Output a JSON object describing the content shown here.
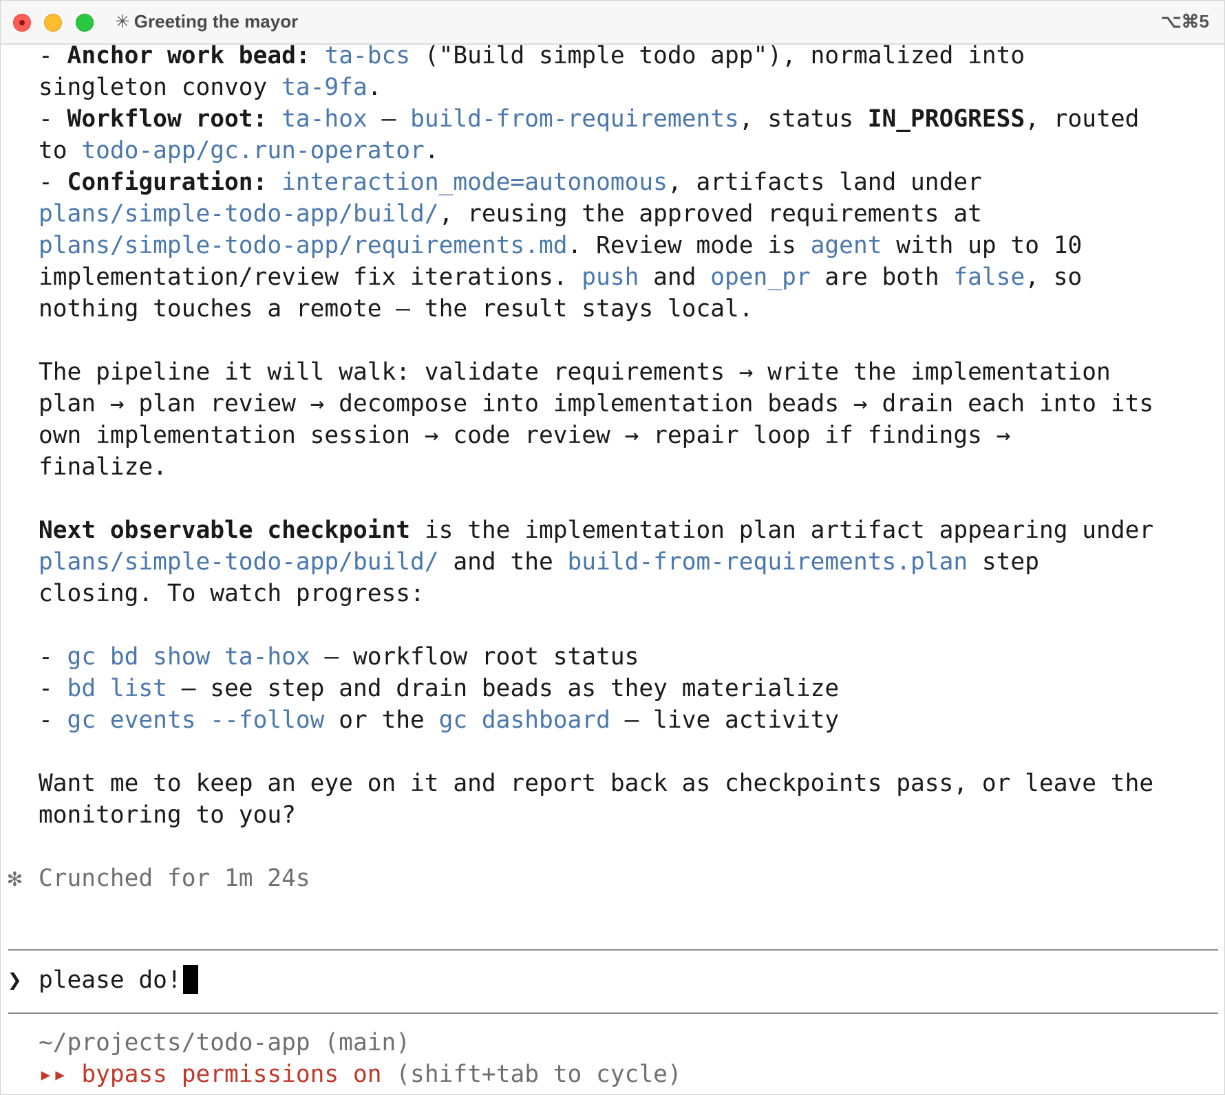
{
  "window": {
    "title_icon": "✳",
    "title": "Greeting the mayor",
    "shortcut": "⌥⌘5"
  },
  "output": {
    "l1": {
      "prefix": "- ",
      "label": "Anchor work bead:",
      "space": " ",
      "code": "ta-bcs",
      "rest": " (\"Build simple todo app\"), normalized into"
    },
    "l2": {
      "text": "singleton convoy ",
      "code": "ta-9fa",
      "end": "."
    },
    "l3": {
      "prefix": "- ",
      "label": "Workflow root:",
      "space": " ",
      "code1": "ta-hox",
      "dash": " — ",
      "code2": "build-from-requirements",
      "mid": ", status ",
      "status": "IN_PROGRESS",
      "end": ", routed"
    },
    "l4": {
      "text": "to ",
      "code": "todo-app/gc.run-operator",
      "end": "."
    },
    "l5": {
      "prefix": "- ",
      "label": "Configuration:",
      "space": " ",
      "code": "interaction_mode=autonomous",
      "rest": ", artifacts land under"
    },
    "l6": {
      "code": "plans/simple-todo-app/build/",
      "rest": ", reusing the approved requirements at"
    },
    "l7": {
      "code1": "plans/simple-todo-app/requirements.md",
      "mid": ". Review mode is ",
      "code2": "agent",
      "rest": " with up to 10"
    },
    "l8": {
      "text": "implementation/review fix iterations. ",
      "code1": "push",
      "and": " and ",
      "code2": "open_pr",
      "mid": " are both ",
      "code3": "false",
      "end": ", so"
    },
    "l9": {
      "text": "nothing touches a remote — the result stays local."
    },
    "p2": [
      "The pipeline it will walk: validate requirements → write the implementation",
      "plan → plan review → decompose into implementation beads → drain each into its",
      "own implementation session → code review → repair loop if findings →",
      "finalize."
    ],
    "l14": {
      "label": "Next observable checkpoint",
      "rest": " is the implementation plan artifact appearing under"
    },
    "l15": {
      "code1": "plans/simple-todo-app/build/",
      "mid": " and the ",
      "code2": "build-from-requirements.plan",
      "end": " step"
    },
    "l16": {
      "text": "closing. To watch progress:"
    },
    "bullets": [
      {
        "prefix": "- ",
        "code": "gc bd show ta-hox",
        "rest": " — workflow root status"
      },
      {
        "prefix": "- ",
        "code": "bd list",
        "rest": " — see step and drain beads as they materialize"
      },
      {
        "prefix": "- ",
        "code1": "gc events --follow",
        "mid": " or the ",
        "code2": "gc dashboard",
        "rest": " — live activity"
      }
    ],
    "question": [
      "Want me to keep an eye on it and report back as checkpoints pass, or leave the",
      "monitoring to you?"
    ]
  },
  "status": {
    "icon": "✻",
    "text": "Crunched for 1m 24s"
  },
  "prompt": {
    "symbol": "❯",
    "input_value": "please do!"
  },
  "footer": {
    "cwd": "~/projects/todo-app (main)",
    "mode_icon": "▸▸",
    "mode_label": "bypass permissions on",
    "mode_hint": " (shift+tab to cycle)"
  },
  "colors": {
    "code": "#4a78ad",
    "dim": "#707070",
    "danger": "#c0392b",
    "cursor": "#000000"
  }
}
